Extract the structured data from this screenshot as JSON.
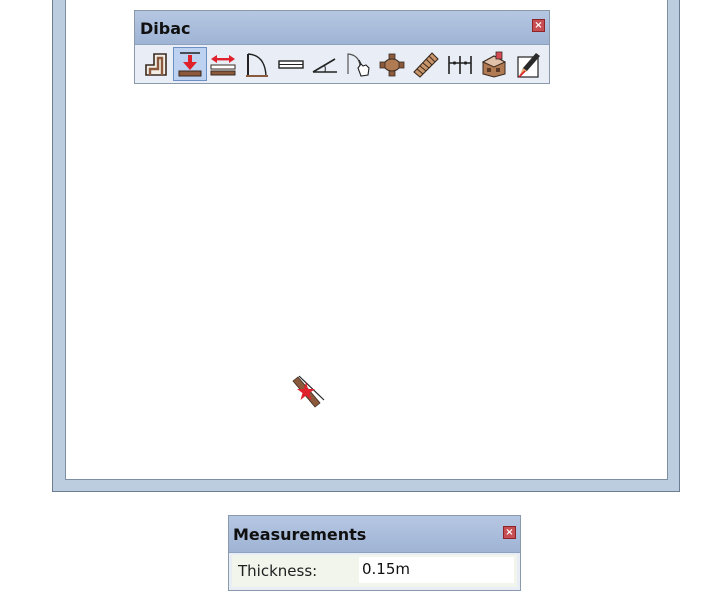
{
  "toolbar": {
    "title": "Dibac",
    "close_label": "×",
    "tools": [
      {
        "name": "wall-tool",
        "icon": "wall-icon"
      },
      {
        "name": "wall-from-line-tool",
        "icon": "wall-from-line-icon",
        "active": true
      },
      {
        "name": "extend-wall-tool",
        "icon": "extend-wall-icon"
      },
      {
        "name": "door-tool",
        "icon": "door-icon"
      },
      {
        "name": "window-tool",
        "icon": "window-icon"
      },
      {
        "name": "opening-tool",
        "icon": "opening-icon"
      },
      {
        "name": "flip-door-tool",
        "icon": "flip-door-icon"
      },
      {
        "name": "furniture-tool",
        "icon": "furniture-icon"
      },
      {
        "name": "stair-tool",
        "icon": "stair-icon"
      },
      {
        "name": "dimension-tool",
        "icon": "dimension-icon"
      },
      {
        "name": "dibac-3d-tool",
        "icon": "3d-model-icon"
      },
      {
        "name": "edit-tool",
        "icon": "edit-pencil-icon"
      }
    ]
  },
  "cursor": {
    "icon": "wall-cursor-icon"
  },
  "measurements": {
    "title": "Measurements",
    "close_label": "×",
    "label": "Thickness:",
    "value": "0.15m"
  },
  "colors": {
    "titlebar": "#a9bcdb",
    "frame": "#bccddf",
    "close_button": "#c74e52",
    "wall_brown": "#8b5a3c",
    "accent_red": "#e0202a"
  }
}
